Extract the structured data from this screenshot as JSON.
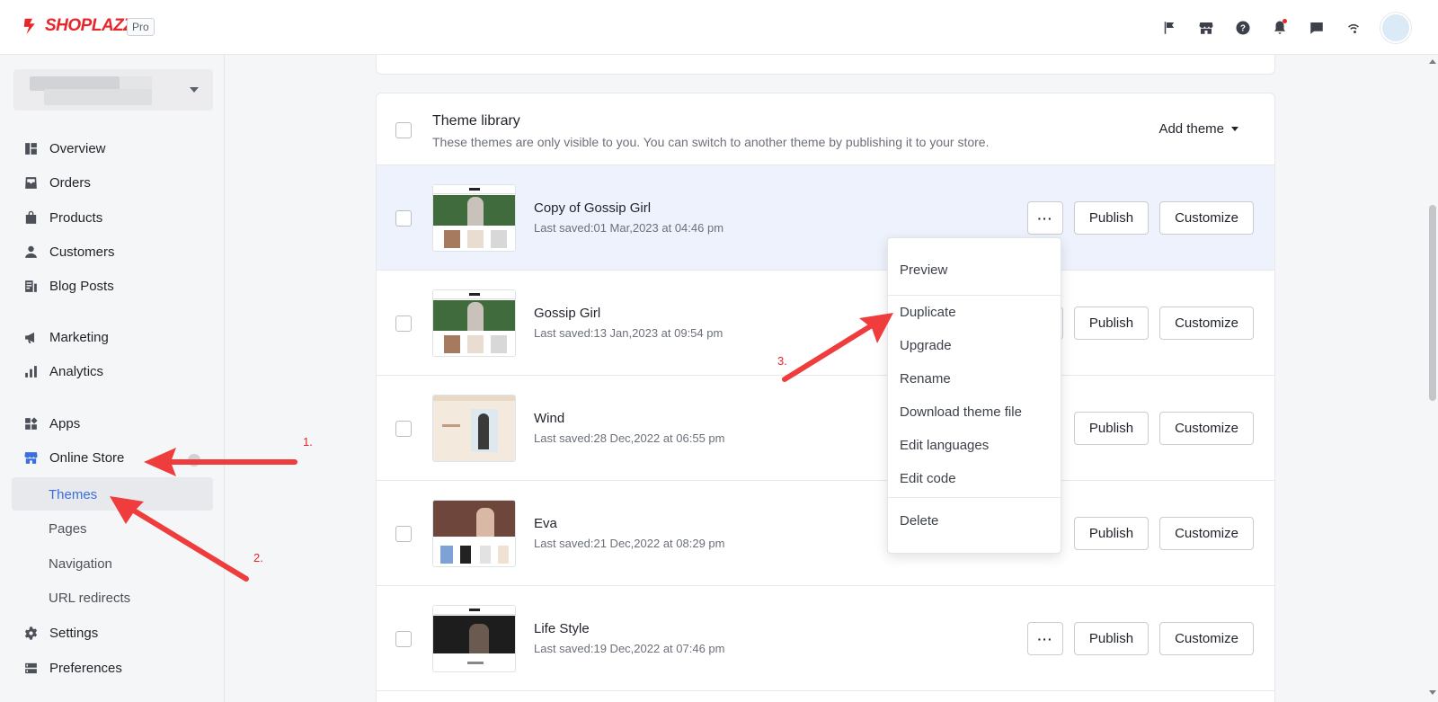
{
  "app": {
    "brand": "SHOPLAZZA",
    "badge": "Pro"
  },
  "colors": {
    "brand": "#e8252b",
    "accent": "#3a6fe0",
    "highlight_row": "#eef2fc"
  },
  "header_icons": [
    "flag-icon",
    "store-icon",
    "help-icon",
    "bell-icon",
    "chat-icon",
    "wifi-icon"
  ],
  "sidebar": {
    "items": [
      {
        "label": "Overview",
        "icon": "overview-icon"
      },
      {
        "label": "Orders",
        "icon": "orders-icon"
      },
      {
        "label": "Products",
        "icon": "products-icon"
      },
      {
        "label": "Customers",
        "icon": "customers-icon"
      },
      {
        "label": "Blog Posts",
        "icon": "blog-icon"
      },
      {
        "label": "Marketing",
        "icon": "megaphone-icon"
      },
      {
        "label": "Analytics",
        "icon": "analytics-icon"
      },
      {
        "label": "Apps",
        "icon": "apps-icon"
      },
      {
        "label": "Online Store",
        "icon": "storefront-icon"
      },
      {
        "label": "Settings",
        "icon": "gear-icon"
      },
      {
        "label": "Preferences",
        "icon": "preferences-icon"
      }
    ],
    "sub_items": [
      "Themes",
      "Pages",
      "Navigation",
      "URL redirects"
    ]
  },
  "library": {
    "title": "Theme library",
    "description": "These themes are only visible to you. You can switch to another theme by publishing it to your store.",
    "add_theme": "Add theme",
    "more_label": "···",
    "publish_label": "Publish",
    "customize_label": "Customize",
    "themes": [
      {
        "name": "Copy of Gossip Girl",
        "saved": "Last saved:01 Mar,2023 at 04:46 pm"
      },
      {
        "name": "Gossip Girl",
        "saved": "Last saved:13 Jan,2023 at 09:54 pm"
      },
      {
        "name": "Wind",
        "saved": "Last saved:28 Dec,2022 at 06:55 pm"
      },
      {
        "name": "Eva",
        "saved": "Last saved:21 Dec,2022 at 08:29 pm"
      },
      {
        "name": "Life Style",
        "saved": "Last saved:19 Dec,2022 at 07:46 pm"
      }
    ]
  },
  "menu": {
    "items": [
      "Preview",
      "Duplicate",
      "Upgrade",
      "Rename",
      "Download theme file",
      "Edit languages",
      "Edit code",
      "Delete"
    ]
  },
  "annotations": {
    "step1": "1.",
    "step2": "2.",
    "step3": "3."
  }
}
